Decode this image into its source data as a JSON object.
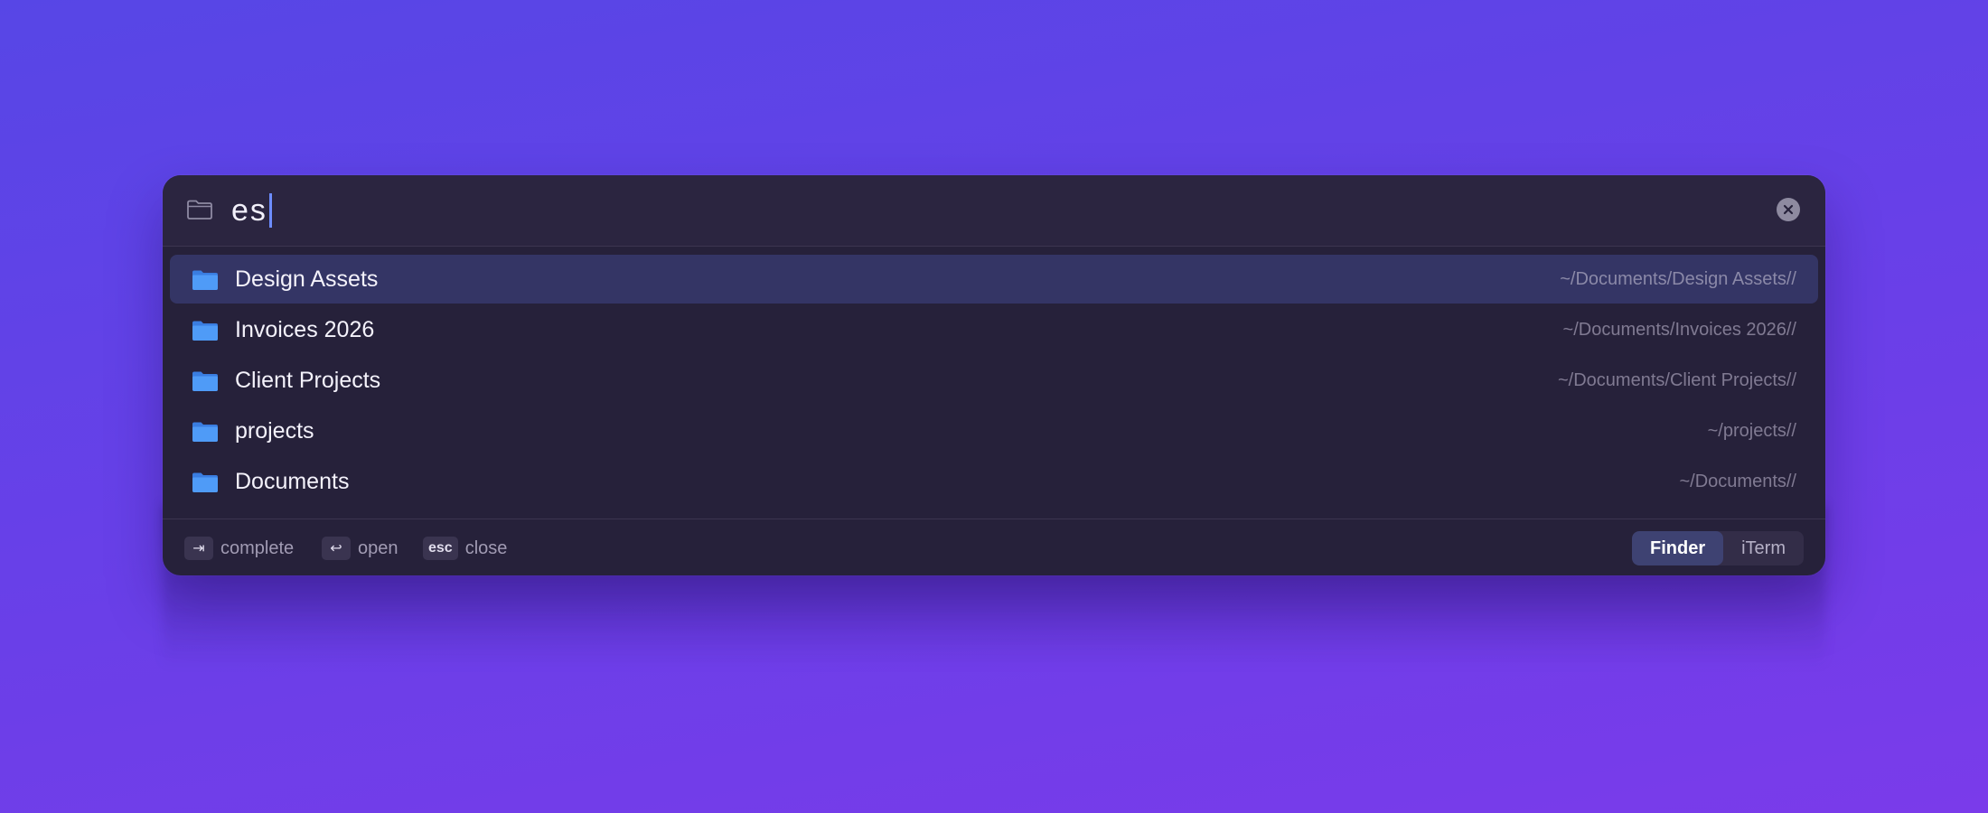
{
  "search": {
    "query": "es"
  },
  "results": [
    {
      "name": "Design Assets",
      "path": "~/Documents/Design Assets//",
      "selected": true
    },
    {
      "name": "Invoices 2026",
      "path": "~/Documents/Invoices 2026//",
      "selected": false
    },
    {
      "name": "Client Projects",
      "path": "~/Documents/Client Projects//",
      "selected": false
    },
    {
      "name": "projects",
      "path": "~/projects//",
      "selected": false
    },
    {
      "name": "Documents",
      "path": "~/Documents//",
      "selected": false
    }
  ],
  "footer": {
    "hints": [
      {
        "key": "⇥",
        "label": "complete"
      },
      {
        "key": "↩",
        "label": "open"
      },
      {
        "key": "esc",
        "label": "close"
      }
    ],
    "targets": [
      {
        "label": "Finder",
        "active": true
      },
      {
        "label": "iTerm",
        "active": false
      }
    ]
  },
  "colors": {
    "folder": "#4a90f5",
    "caret": "#6d8cff",
    "selected_row": "#343565"
  },
  "icons": {
    "search_field": "folder-outline-icon",
    "result": "folder-icon",
    "clear": "close-circle-icon"
  }
}
